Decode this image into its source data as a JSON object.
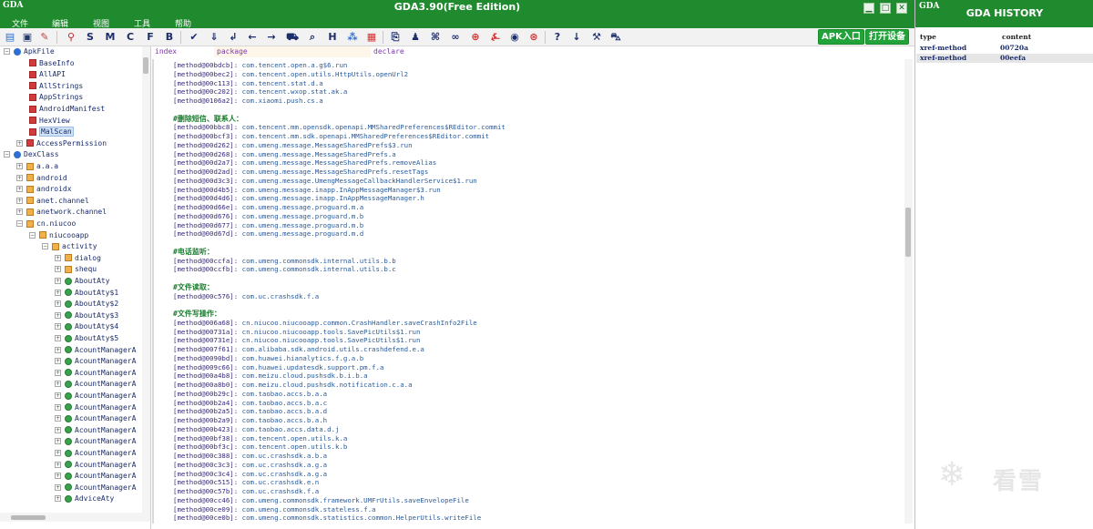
{
  "window": {
    "title": "GDA3.90(Free Edition)",
    "logo": "GDA"
  },
  "menu": [
    {
      "label": "文件"
    },
    {
      "label": "编辑"
    },
    {
      "label": "视图"
    },
    {
      "label": "工具"
    },
    {
      "label": "帮助"
    }
  ],
  "toolbar": {
    "letters": [
      "S",
      "M",
      "C",
      "F",
      "B"
    ],
    "apk_entry": "APK入口",
    "open_device": "打开设备"
  },
  "columns": {
    "index": "index",
    "package": "package",
    "declare": "declare"
  },
  "tree": [
    {
      "label": "ApkFile",
      "exp": "⊟",
      "icon": "root"
    },
    {
      "label": "BaseInfo",
      "icon": "file"
    },
    {
      "label": "AllAPI",
      "icon": "file"
    },
    {
      "label": "AllStrings",
      "icon": "file"
    },
    {
      "label": "AppStrings",
      "icon": "file"
    },
    {
      "label": "AndroidManifest",
      "icon": "file"
    },
    {
      "label": "HexView",
      "icon": "file"
    },
    {
      "label": "MalScan",
      "icon": "file",
      "selected": true
    },
    {
      "label": "AccessPermission",
      "icon": "file",
      "exp": "⊞"
    },
    {
      "label": "DexClass",
      "exp": "⊟",
      "icon": "root"
    },
    {
      "label": "a.a.a",
      "exp": "⊞",
      "icon": "pkg"
    },
    {
      "label": "android",
      "exp": "⊞",
      "icon": "pkg"
    },
    {
      "label": "androidx",
      "exp": "⊞",
      "icon": "pkg"
    },
    {
      "label": "anet.channel",
      "exp": "⊞",
      "icon": "pkg"
    },
    {
      "label": "anetwork.channel",
      "exp": "⊞",
      "icon": "pkg"
    },
    {
      "label": "cn.niucoo",
      "exp": "⊟",
      "icon": "pkg"
    },
    {
      "label": "niucooapp",
      "exp": "⊟",
      "icon": "pkg"
    },
    {
      "label": "activity",
      "exp": "⊟",
      "icon": "pkg"
    },
    {
      "label": "dialog",
      "exp": "⊞",
      "icon": "pkg"
    },
    {
      "label": "shequ",
      "exp": "⊞",
      "icon": "pkg"
    },
    {
      "label": "AboutAty",
      "exp": "⊞",
      "icon": "cls"
    },
    {
      "label": "AboutAty$1",
      "exp": "⊞",
      "icon": "cls"
    },
    {
      "label": "AboutAty$2",
      "exp": "⊞",
      "icon": "cls"
    },
    {
      "label": "AboutAty$3",
      "exp": "⊞",
      "icon": "cls"
    },
    {
      "label": "AboutAty$4",
      "exp": "⊞",
      "icon": "cls"
    },
    {
      "label": "AboutAty$5",
      "exp": "⊞",
      "icon": "cls"
    },
    {
      "label": "AcountManagerA",
      "exp": "⊞",
      "icon": "cls"
    },
    {
      "label": "AcountManagerA",
      "exp": "⊞",
      "icon": "cls"
    },
    {
      "label": "AcountManagerA",
      "exp": "⊞",
      "icon": "cls"
    },
    {
      "label": "AcountManagerA",
      "exp": "⊞",
      "icon": "cls"
    },
    {
      "label": "AcountManagerA",
      "exp": "⊞",
      "icon": "cls"
    },
    {
      "label": "AcountManagerA",
      "exp": "⊞",
      "icon": "cls"
    },
    {
      "label": "AcountManagerA",
      "exp": "⊞",
      "icon": "cls"
    },
    {
      "label": "AcountManagerA",
      "exp": "⊞",
      "icon": "cls"
    },
    {
      "label": "AcountManagerA",
      "exp": "⊞",
      "icon": "cls"
    },
    {
      "label": "AcountManagerA",
      "exp": "⊞",
      "icon": "cls"
    },
    {
      "label": "AcountManagerA",
      "exp": "⊞",
      "icon": "cls"
    },
    {
      "label": "AcountManagerA",
      "exp": "⊞",
      "icon": "cls"
    },
    {
      "label": "AcountManagerA",
      "exp": "⊞",
      "icon": "cls"
    },
    {
      "label": "AdviceAty",
      "exp": "⊞",
      "icon": "cls"
    }
  ],
  "code": [
    {
      "addr": "[method@00bdcb]:",
      "meth": "com.tencent.open.a.g$6.run"
    },
    {
      "addr": "[method@00bec2]:",
      "meth": "com.tencent.open.utils.HttpUtils.openUrl2"
    },
    {
      "addr": "[method@00c113]:",
      "meth": "com.tencent.stat.d.a"
    },
    {
      "addr": "[method@00c202]:",
      "meth": "com.tencent.wxop.stat.ak.a"
    },
    {
      "addr": "[method@0106a2]:",
      "meth": "com.xiaomi.push.cs.a"
    },
    {
      "blank": true
    },
    {
      "heading": "#删除短信、联系人："
    },
    {
      "addr": "[method@00bbc8]:",
      "meth": "com.tencent.mm.opensdk.openapi.MMSharedPreferences$REditor.commit"
    },
    {
      "addr": "[method@00bcf3]:",
      "meth": "com.tencent.mm.sdk.openapi.MMSharedPreferences$REditor.commit"
    },
    {
      "addr": "[method@00d262]:",
      "meth": "com.umeng.message.MessageSharedPrefs$3.run"
    },
    {
      "addr": "[method@00d268]:",
      "meth": "com.umeng.message.MessageSharedPrefs.a"
    },
    {
      "addr": "[method@00d2a7]:",
      "meth": "com.umeng.message.MessageSharedPrefs.removeAlias"
    },
    {
      "addr": "[method@00d2ad]:",
      "meth": "com.umeng.message.MessageSharedPrefs.resetTags"
    },
    {
      "addr": "[method@00d3c3]:",
      "meth": "com.umeng.message.UmengMessageCallbackHandlerService$1.run"
    },
    {
      "addr": "[method@00d4b5]:",
      "meth": "com.umeng.message.inapp.InAppMessageManager$3.run"
    },
    {
      "addr": "[method@00d4d6]:",
      "meth": "com.umeng.message.inapp.InAppMessageManager.h"
    },
    {
      "addr": "[method@00d66e]:",
      "meth": "com.umeng.message.proguard.m.a"
    },
    {
      "addr": "[method@00d676]:",
      "meth": "com.umeng.message.proguard.m.b"
    },
    {
      "addr": "[method@00d677]:",
      "meth": "com.umeng.message.proguard.m.b"
    },
    {
      "addr": "[method@00d67d]:",
      "meth": "com.umeng.message.proguard.m.d"
    },
    {
      "blank": true
    },
    {
      "heading": "#电话监听："
    },
    {
      "addr": "[method@00ccfa]:",
      "meth": "com.umeng.commonsdk.internal.utils.b.b"
    },
    {
      "addr": "[method@00ccfb]:",
      "meth": "com.umeng.commonsdk.internal.utils.b.c"
    },
    {
      "blank": true
    },
    {
      "heading": "#文件读取："
    },
    {
      "addr": "[method@00c576]:",
      "meth": "com.uc.crashsdk.f.a"
    },
    {
      "blank": true
    },
    {
      "heading": "#文件写操作："
    },
    {
      "addr": "[method@006a68]:",
      "meth": "cn.niucoo.niucooapp.common.CrashHandler.saveCrashInfo2File"
    },
    {
      "addr": "[method@00731a]:",
      "meth": "cn.niucoo.niucooapp.tools.SavePicUtils$1.run"
    },
    {
      "addr": "[method@00731e]:",
      "meth": "cn.niucoo.niucooapp.tools.SavePicUtils$1.run"
    },
    {
      "addr": "[method@007f61]:",
      "meth": "com.alibaba.sdk.android.utils.crashdefend.e.a"
    },
    {
      "addr": "[method@0090bd]:",
      "meth": "com.huawei.hianalytics.f.g.a.b"
    },
    {
      "addr": "[method@009c66]:",
      "meth": "com.huawei.updatesdk.support.pm.f.a"
    },
    {
      "addr": "[method@00a4b8]:",
      "meth": "com.meizu.cloud.pushsdk.b.i.b.a"
    },
    {
      "addr": "[method@00a8b0]:",
      "meth": "com.meizu.cloud.pushsdk.notification.c.a.a"
    },
    {
      "addr": "[method@00b29c]:",
      "meth": "com.taobao.accs.b.a.a"
    },
    {
      "addr": "[method@00b2a4]:",
      "meth": "com.taobao.accs.b.a.c"
    },
    {
      "addr": "[method@00b2a5]:",
      "meth": "com.taobao.accs.b.a.d"
    },
    {
      "addr": "[method@00b2a9]:",
      "meth": "com.taobao.accs.b.a.h"
    },
    {
      "addr": "[method@00b423]:",
      "meth": "com.taobao.accs.data.d.j"
    },
    {
      "addr": "[method@00bf38]:",
      "meth": "com.tencent.open.utils.k.a"
    },
    {
      "addr": "[method@00bf3c]:",
      "meth": "com.tencent.open.utils.k.b"
    },
    {
      "addr": "[method@00c388]:",
      "meth": "com.uc.crashsdk.a.b.a"
    },
    {
      "addr": "[method@00c3c3]:",
      "meth": "com.uc.crashsdk.a.g.a"
    },
    {
      "addr": "[method@00c3c4]:",
      "meth": "com.uc.crashsdk.a.g.a"
    },
    {
      "addr": "[method@00c515]:",
      "meth": "com.uc.crashsdk.e.n"
    },
    {
      "addr": "[method@00c57b]:",
      "meth": "com.uc.crashsdk.f.a"
    },
    {
      "addr": "[method@00cc46]:",
      "meth": "com.umeng.commonsdk.framework.UMFrUtils.saveEnvelopeFile"
    },
    {
      "addr": "[method@00ce09]:",
      "meth": "com.umeng.commonsdk.stateless.f.a"
    },
    {
      "addr": "[method@00ce0b]:",
      "meth": "com.umeng.commonsdk.statistics.common.HelperUtils.writeFile"
    }
  ],
  "history": {
    "title": "GDA HISTORY",
    "logo": "GDA",
    "col_type": "type",
    "col_content": "content",
    "rows": [
      {
        "type": "xref-method",
        "content": "00720a",
        "selected": false
      },
      {
        "type": "xref-method",
        "content": "00eefa",
        "selected": true
      }
    ]
  },
  "watermark": {
    "text": "看雪"
  },
  "colors": {
    "title_green": "#1f8b2e",
    "button_green": "#22a33a",
    "heading_green": "#1a7d2e"
  }
}
